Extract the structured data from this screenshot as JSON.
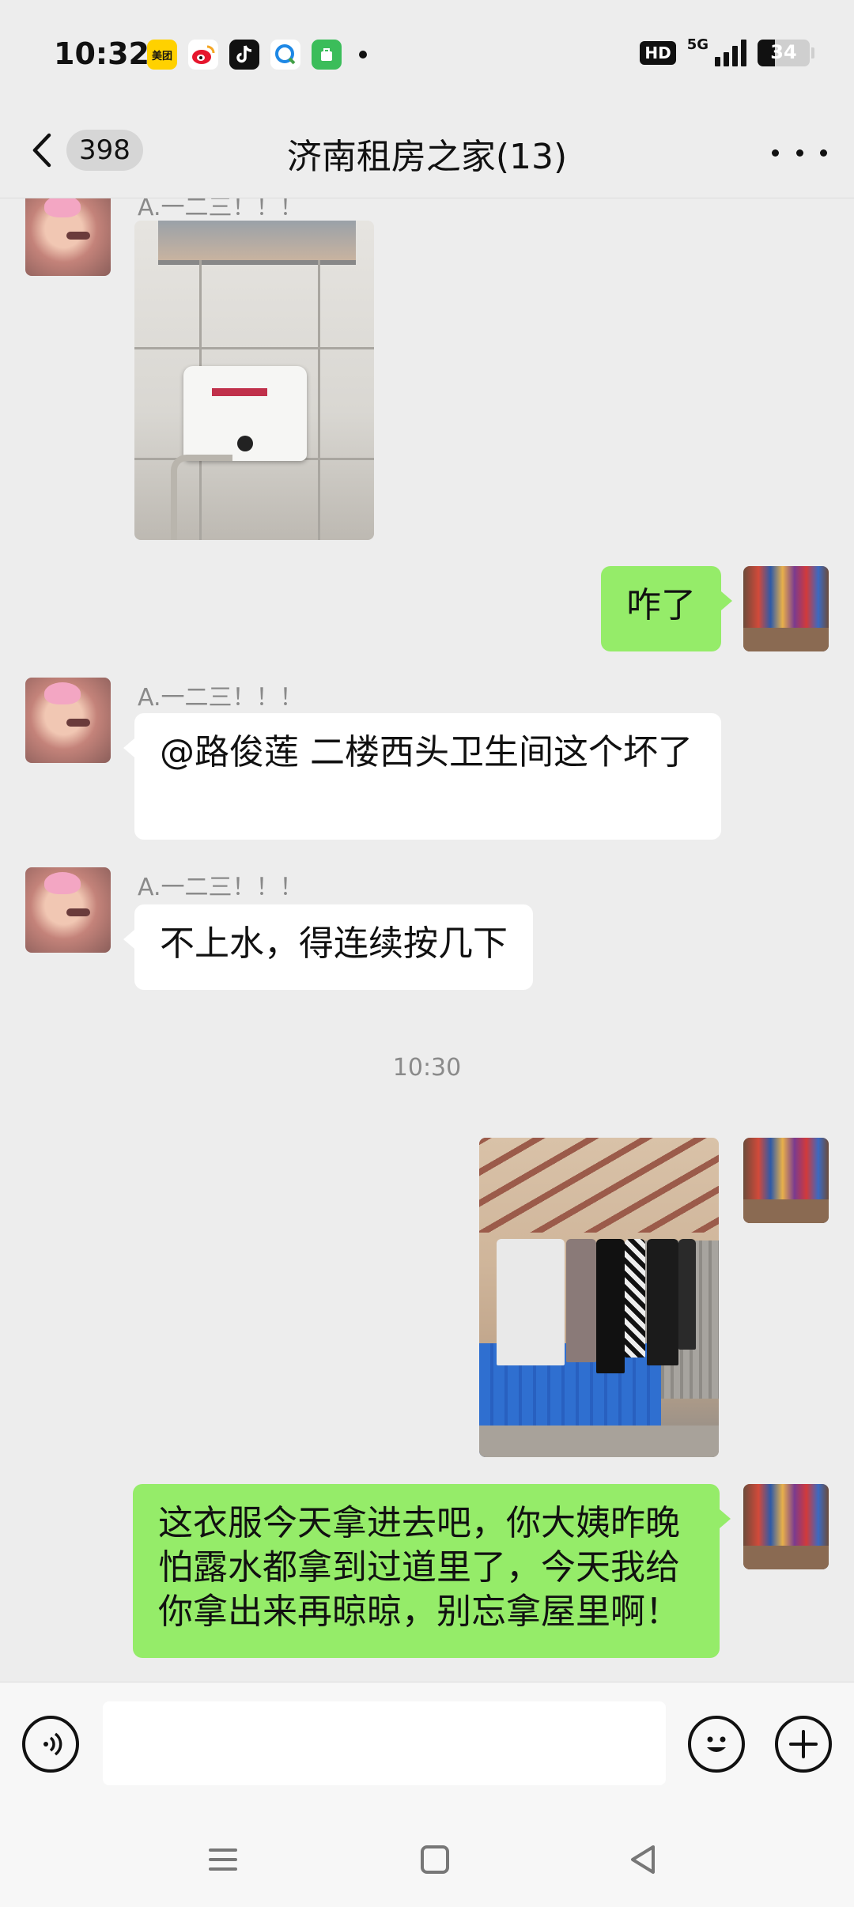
{
  "status_bar": {
    "time": "10:32",
    "app_icons": [
      {
        "name": "meituan-icon",
        "label": "美团",
        "color": "#ffd100"
      },
      {
        "name": "weibo-icon",
        "label": "",
        "color": "#ffffff"
      },
      {
        "name": "tiktok-icon",
        "label": "",
        "color": "#111111"
      },
      {
        "name": "qq-browser-icon",
        "label": "",
        "color": "#ffffff"
      },
      {
        "name": "mini-app-icon",
        "label": "",
        "color": "#3bbd5a"
      }
    ],
    "hd_label": "HD",
    "network_label": "5G",
    "battery_level": "34"
  },
  "header": {
    "unread_count": "398",
    "title": "济南租房之家(13)"
  },
  "messages": [
    {
      "id": "m1",
      "direction": "in",
      "sender": "A.一二三！！！",
      "type": "image",
      "image_desc": "toilet-tank-photo"
    },
    {
      "id": "m2",
      "direction": "out",
      "type": "text",
      "text": "咋了"
    },
    {
      "id": "m3",
      "direction": "in",
      "sender": "A.一二三！！！",
      "type": "text",
      "text": "@路俊莲  二楼西头卫生间这个坏了"
    },
    {
      "id": "m4",
      "direction": "in",
      "sender": "A.一二三！！！",
      "type": "text",
      "text": "不上水，得连续按几下"
    },
    {
      "id": "t1",
      "type": "time",
      "text": "10:30"
    },
    {
      "id": "m5",
      "direction": "out",
      "type": "image",
      "image_desc": "clothes-drying-photo"
    },
    {
      "id": "m6",
      "direction": "out",
      "type": "text",
      "text": "这衣服今天拿进去吧，你大姨昨晚怕露水都拿到过道里了，今天我给你拿出来再晾晾，别忘拿屋里啊！"
    }
  ],
  "input_bar": {
    "value": "",
    "placeholder": ""
  },
  "colors": {
    "background": "#ededed",
    "outgoing_bubble": "#95ec69",
    "incoming_bubble": "#ffffff",
    "meta_text": "#8a8a8a"
  }
}
